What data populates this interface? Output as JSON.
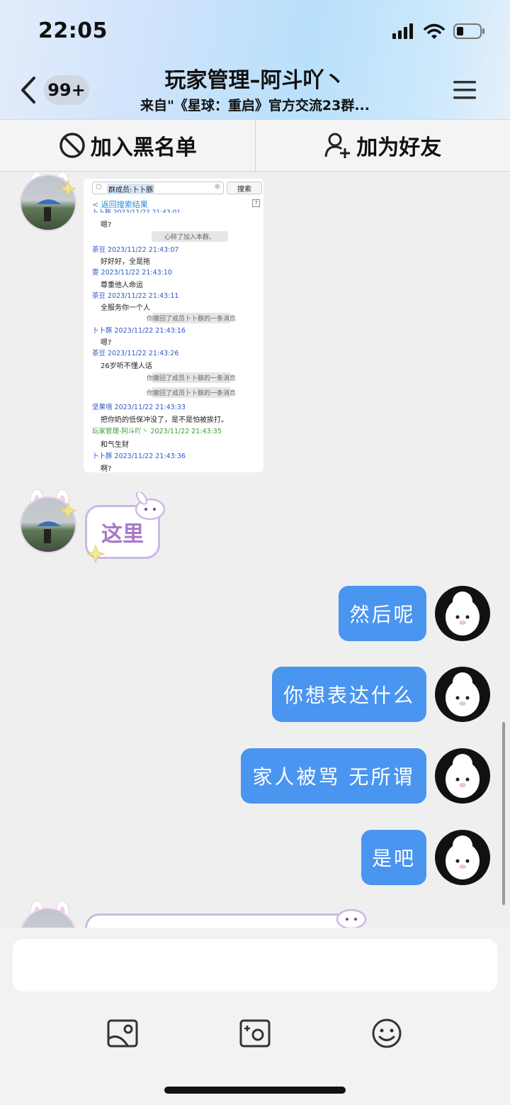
{
  "status_bar": {
    "time": "22:05"
  },
  "header": {
    "badge": "99+",
    "title": "玩家管理–阿斗吖丶",
    "subtitle": "来自\"《星球：重启》官方交流23群..."
  },
  "actions": {
    "blacklist": "加入黑名单",
    "add_friend": "加为好友"
  },
  "screenshot": {
    "search_text": "群成员:卜卜豚",
    "search_button": "搜索",
    "back_link": "< 返回搜索结果",
    "top_partial": "卜卜豚 2023/11/22 21:43:01",
    "entries": [
      {
        "kind": "text",
        "text": "嗯?"
      },
      {
        "kind": "sys",
        "text": "心碎了加入本群。"
      },
      {
        "kind": "name",
        "text": "茶豆 2023/11/22 21:43:07"
      },
      {
        "kind": "text",
        "text": "好好好，全是拖"
      },
      {
        "kind": "name",
        "text": "雯 2023/11/22 21:43:10"
      },
      {
        "kind": "text",
        "text": "尊重他人命运"
      },
      {
        "kind": "name",
        "text": "茶豆 2023/11/22 21:43:11"
      },
      {
        "kind": "text",
        "text": "全服务你一个人"
      },
      {
        "kind": "sys",
        "text": "你撤回了成员卜卜豚的一条消息"
      },
      {
        "kind": "name",
        "text": "卜卜豚 2023/11/22 21:43:16"
      },
      {
        "kind": "text",
        "text": "嗯?"
      },
      {
        "kind": "name",
        "text": "茶豆 2023/11/22 21:43:26"
      },
      {
        "kind": "text",
        "text": "26岁听不懂人话"
      },
      {
        "kind": "sys",
        "text": "你撤回了成员卜卜豚的一条消息"
      },
      {
        "kind": "sys",
        "text": "你撤回了成员卜卜豚的一条消息"
      },
      {
        "kind": "name",
        "text": "坚果墙 2023/11/22 21:43:33"
      },
      {
        "kind": "text",
        "text": "把你奶的低保冲没了，是不是怕被挨打。"
      },
      {
        "kind": "name_green",
        "text": "玩家管理-阿斗吖丶 2023/11/22 21:43:35"
      },
      {
        "kind": "text",
        "text": "和气生财"
      },
      {
        "kind": "name",
        "text": "卜卜豚 2023/11/22 21:43:36"
      },
      {
        "kind": "text",
        "text": "啊?"
      }
    ]
  },
  "sticker_text": "这里",
  "messages": [
    {
      "text": "然后呢"
    },
    {
      "text": "你想表达什么"
    },
    {
      "text": "家人被骂 无所谓"
    },
    {
      "text": "是吧"
    }
  ],
  "colors": {
    "bubble_blue": "#4a95f0",
    "name_blue": "#2e58c8",
    "name_green": "#3a9a3a",
    "sticker_purple": "#a878c8"
  },
  "icons": [
    "back-chevron-icon",
    "menu-icon",
    "block-icon",
    "add-user-icon",
    "image-icon",
    "camera-icon",
    "emoji-icon"
  ]
}
